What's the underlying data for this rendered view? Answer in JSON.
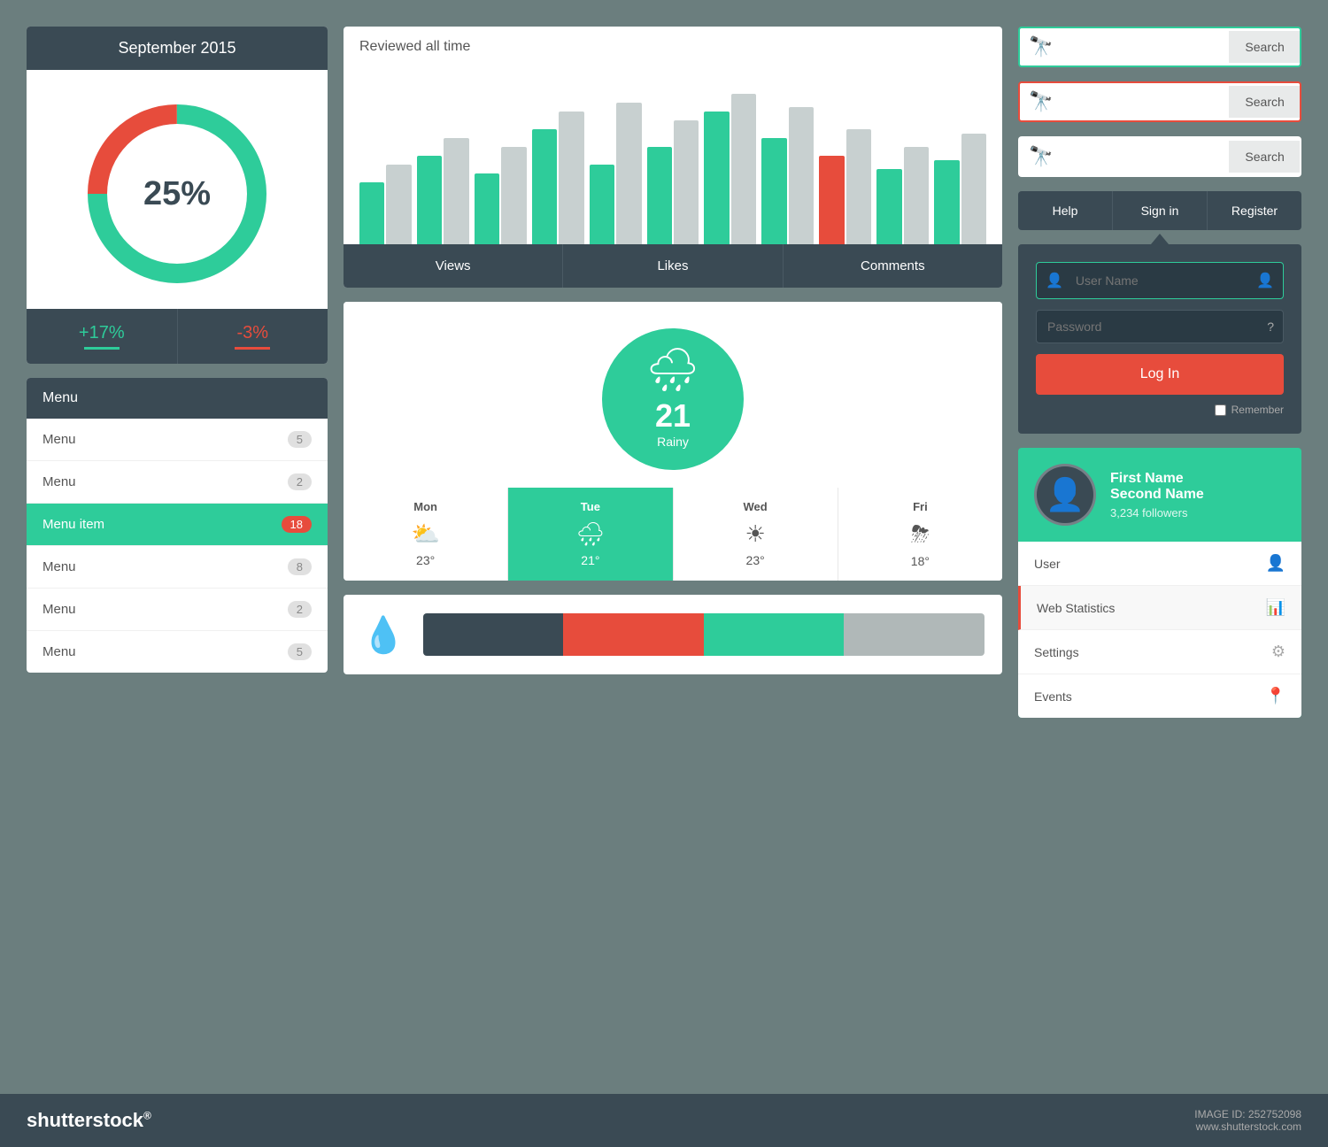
{
  "calendar": {
    "title": "September 2015",
    "percentage": "25%",
    "stat1_label": "+17%",
    "stat2_label": "-3%"
  },
  "menu": {
    "header": "Menu",
    "items": [
      {
        "label": "Menu",
        "badge": "5",
        "active": false
      },
      {
        "label": "Menu",
        "badge": "2",
        "active": false
      },
      {
        "label": "Menu item",
        "badge": "18",
        "active": true
      },
      {
        "label": "Menu",
        "badge": "8",
        "active": false
      },
      {
        "label": "Menu",
        "badge": "2",
        "active": false
      },
      {
        "label": "Menu",
        "badge": "5",
        "active": false
      }
    ]
  },
  "chart": {
    "title": "Reviewed all time",
    "footer_items": [
      "Views",
      "Likes",
      "Comments"
    ]
  },
  "weather": {
    "temp": "21",
    "desc": "Rainy",
    "days": [
      {
        "name": "Mon",
        "temp": "23°",
        "active": false
      },
      {
        "name": "Tue",
        "temp": "21°",
        "active": true
      },
      {
        "name": "Wed",
        "temp": "23°",
        "active": false
      },
      {
        "name": "Fri",
        "temp": "18°",
        "active": false
      }
    ]
  },
  "search_boxes": [
    {
      "placeholder": "",
      "button": "Search",
      "border": "teal"
    },
    {
      "placeholder": "",
      "button": "Search",
      "border": "red"
    },
    {
      "placeholder": "",
      "button": "Search",
      "border": "none"
    }
  ],
  "nav": {
    "items": [
      "Help",
      "Sign in",
      "Register"
    ]
  },
  "login": {
    "username_placeholder": "User Name",
    "password_placeholder": "Password",
    "button": "Log In",
    "remember": "Remember"
  },
  "profile": {
    "first_name": "First Name",
    "second_name": "Second Name",
    "followers": "3,234 followers",
    "menu_items": [
      {
        "label": "User",
        "icon": "👤"
      },
      {
        "label": "Web Statistics",
        "icon": "📊"
      },
      {
        "label": "Settings",
        "icon": "⚙"
      },
      {
        "label": "Events",
        "icon": "📍"
      }
    ]
  },
  "footer": {
    "brand": "shutterstock",
    "image_id": "IMAGE ID: 252752098",
    "url": "www.shutterstock.com"
  },
  "colors": {
    "teal": "#2ecc9a",
    "dark": "#3a4a54",
    "red": "#e74c3c",
    "gray": "#b0b8b8"
  }
}
